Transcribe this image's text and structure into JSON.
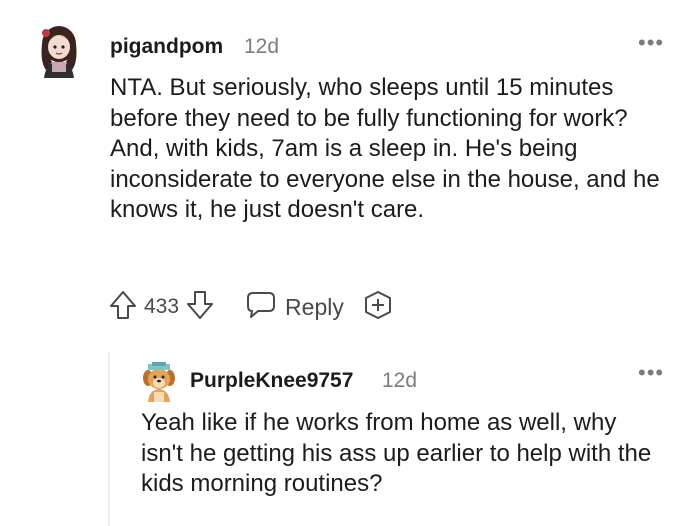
{
  "comment": {
    "username": "pigandpom",
    "time": "12d",
    "text": "NTA. But seriously, who sleeps until 15 minutes before they need to be fully functioning for work? And, with kids, 7am is a sleep in. He's being inconsiderate to everyone else in the house, and he knows it, he just doesn't care.",
    "votes": "433",
    "reply_label": "Reply",
    "more_icon": "more-dots-icon",
    "icons": [
      "upvote-arrow-icon",
      "downvote-arrow-icon",
      "reply-bubble-icon",
      "award-plus-icon"
    ]
  },
  "reply": {
    "username": "PurpleKnee9757",
    "time": "12d",
    "text": "Yeah like if he works from home as well, why isn't he getting his ass up earlier to help with the kids morning routines?",
    "more_icon": "more-dots-icon"
  },
  "colors": {
    "text": "#1c1c1c",
    "meta": "#7c7c7c",
    "thread_line": "#ececec"
  }
}
